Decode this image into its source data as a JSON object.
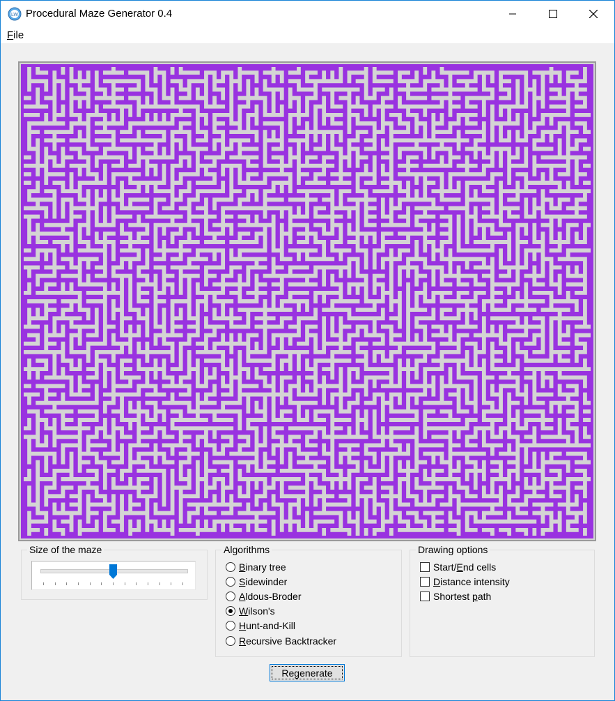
{
  "window": {
    "title": "Procedural Maze Generator 0.4",
    "icon": "app-maze-icon",
    "controls": [
      "minimize-icon",
      "maximize-icon",
      "close-icon"
    ]
  },
  "menu": {
    "file": {
      "access_key": "F",
      "rest": "ile"
    }
  },
  "maze": {
    "wall_color": "#9932e0",
    "floor_color": "#d4d4d4",
    "algorithm_shown": "Wilson's"
  },
  "size_group": {
    "title": "Size of the maze",
    "slider_value": 6,
    "slider_min": 0,
    "slider_max": 12,
    "accent": "#0078d7"
  },
  "algorithms_group": {
    "title": "Algorithms",
    "options": [
      {
        "key": "B",
        "rest": "inary tree",
        "selected": false
      },
      {
        "key": "S",
        "rest": "idewinder",
        "selected": false
      },
      {
        "key": "A",
        "rest": "ldous-Broder",
        "selected": false
      },
      {
        "key": "W",
        "rest": "ilson's",
        "selected": true
      },
      {
        "key": "H",
        "rest": "unt-and-Kill",
        "selected": false
      },
      {
        "key": "R",
        "rest": "ecursive Backtracker",
        "selected": false
      }
    ]
  },
  "drawing_group": {
    "title": "Drawing options",
    "options": [
      {
        "pre": "Start/",
        "key": "E",
        "rest": "nd cells",
        "checked": false
      },
      {
        "pre": "",
        "key": "D",
        "rest": "istance intensity",
        "checked": false
      },
      {
        "pre": "Shortest ",
        "key": "p",
        "rest": "ath",
        "checked": false
      }
    ]
  },
  "regenerate": {
    "label": "Regenerate"
  }
}
